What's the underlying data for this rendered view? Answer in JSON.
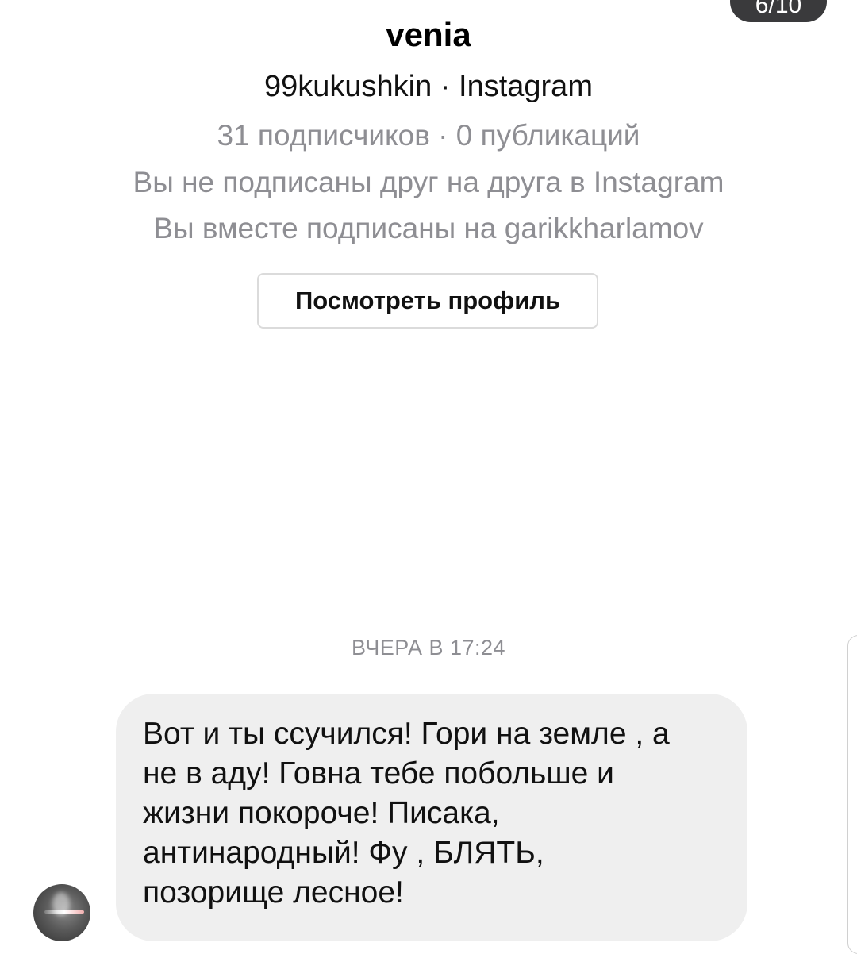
{
  "header": {
    "counter_text": "6/10"
  },
  "profile": {
    "name": "venia",
    "handle_line": "99kukushkin · Instagram",
    "stats_line": "31 подписчиков · 0 публикаций",
    "follow_status_line": "Вы не подписаны друг на друга в Instagram",
    "mutual_line": "Вы вместе подписаны на garikkharlamov",
    "view_profile_label": "Посмотреть профиль"
  },
  "thread": {
    "timestamp": "ВЧЕРА В 17:24",
    "messages": [
      {
        "text": "Вот и ты ссучился! Гори на земле , а\nне в аду! Говна тебе побольше и\nжизни покороче! Писака,\nантинародный!  Фу , БЛЯТЬ,\nпозорище лесное!"
      }
    ]
  },
  "icons": {
    "avatar": "sender-avatar"
  },
  "colors": {
    "bubble_bg": "#efefef",
    "muted_text": "#8e8e93",
    "pill_bg": "#3a3a3c"
  }
}
